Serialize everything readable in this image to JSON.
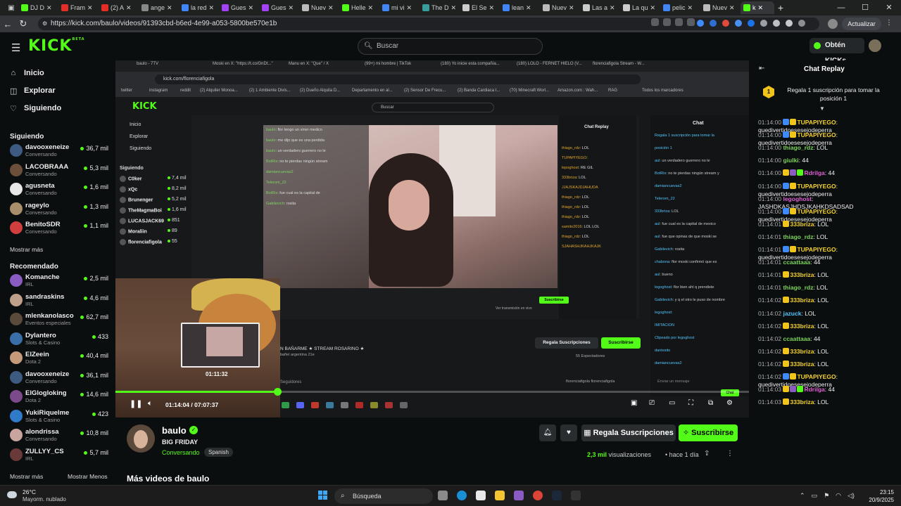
{
  "browser": {
    "tabs": [
      {
        "label": "DJ D",
        "color": "#53fc18"
      },
      {
        "label": "Fram",
        "color": "#e52d27"
      },
      {
        "label": "(2) A",
        "color": "#e52d27"
      },
      {
        "label": "ange",
        "color": "#888888"
      },
      {
        "label": "la red",
        "color": "#4285f4"
      },
      {
        "label": "Gues",
        "color": "#a142f4"
      },
      {
        "label": "Gues",
        "color": "#a142f4"
      },
      {
        "label": "Nuev",
        "color": "#bbbbbb"
      },
      {
        "label": "Helle",
        "color": "#53fc18"
      },
      {
        "label": "mi vi",
        "color": "#4285f4"
      },
      {
        "label": "The D",
        "color": "#3a9d9d"
      },
      {
        "label": "El Se",
        "color": "#cccccc"
      },
      {
        "label": "lean",
        "color": "#4285f4"
      },
      {
        "label": "Nuev",
        "color": "#bbbbbb"
      },
      {
        "label": "Las a",
        "color": "#cccccc"
      },
      {
        "label": "La qu",
        "color": "#cccccc"
      },
      {
        "label": "pelic",
        "color": "#4285f4"
      },
      {
        "label": "Nuev",
        "color": "#bbbbbb"
      }
    ],
    "active_tab": {
      "label": "k",
      "color": "#53fc18"
    },
    "url": "https://kick.com/baulo/videos/91393cbd-b6ed-4e99-a053-5800be570e1b",
    "update_label": "Actualizar"
  },
  "header": {
    "logo": "KICK",
    "logo_sup": "BETA",
    "search_placeholder": "Buscar",
    "kicks_label": "Obtén KICKs"
  },
  "sidebar": {
    "nav": [
      {
        "label": "Inicio",
        "icon": "home-icon"
      },
      {
        "label": "Explorar",
        "icon": "compass-icon"
      },
      {
        "label": "Siguiendo",
        "icon": "heart-icon"
      }
    ],
    "following_title": "Siguiendo",
    "following": [
      {
        "name": "davooxeneize",
        "category": "Conversando",
        "viewers": "36,7 mil",
        "color": "#3d5a80"
      },
      {
        "name": "LACOBRAAA",
        "category": "Conversando",
        "viewers": "5,3 mil",
        "color": "#6b4f3a"
      },
      {
        "name": "agusneta",
        "category": "Conversando",
        "viewers": "1,6 mil",
        "color": "#e8e8e8"
      },
      {
        "name": "rageylo",
        "category": "Conversando",
        "viewers": "1,3 mil",
        "color": "#a88e6a"
      },
      {
        "name": "BenitoSDR",
        "category": "Conversando",
        "viewers": "1,1 mil",
        "color": "#d23d3d"
      }
    ],
    "show_more": "Mostrar más",
    "recommended_title": "Recomendado",
    "recommended": [
      {
        "name": "Komanche",
        "category": "IRL",
        "viewers": "2,5 mil",
        "color": "#8a5cc2"
      },
      {
        "name": "sandraskins",
        "category": "IRL",
        "viewers": "4,6 mil",
        "color": "#bfa08a"
      },
      {
        "name": "mlenkanolasco",
        "category": "Eventos especiales",
        "viewers": "62,7 mil",
        "color": "#5a4a3a"
      },
      {
        "name": "Dylantero",
        "category": "Slots & Casino",
        "viewers": "433",
        "color": "#3a6ea8"
      },
      {
        "name": "ElZeein",
        "category": "Dota 2",
        "viewers": "40,4 mil",
        "color": "#c49a7a"
      },
      {
        "name": "davooxeneize",
        "category": "Conversando",
        "viewers": "36,1 mil",
        "color": "#3d5a80"
      },
      {
        "name": "ElGlogloking",
        "category": "Dota 2",
        "viewers": "14,6 mil",
        "color": "#7a4a8a"
      },
      {
        "name": "YukiRiquelme",
        "category": "Slots & Casino",
        "viewers": "423",
        "color": "#2f7ac9"
      },
      {
        "name": "alondrissa",
        "category": "Conversando",
        "viewers": "10,8 mil",
        "color": "#caa5a0"
      },
      {
        "name": "ZULLYY_CS",
        "category": "IRL",
        "viewers": "5,7 mil",
        "color": "#6a3a3a"
      }
    ],
    "show_more_bottom": "Mostrar más",
    "show_less": "Mostrar Menos"
  },
  "player": {
    "inner_tabs": [
      "baulo - 7TV",
      "Moski en X: \"https://t.co/GnDt...\"",
      "Manu en X: \"Que\" / X",
      "(99+) mi hombre | TikTok",
      "(180) Yo inicie esta compañía...",
      "(180) LOLO - FERNET HIELO (V...",
      "florenciafigola Stream - W..."
    ],
    "inner_url": "kick.com/florenciafigola",
    "bookmarks": [
      "twitter",
      "instagram",
      "reddit",
      "(2) Alquiler Monoa...",
      "(2) 1 Ambiente Divis...",
      "(2) Dueño Alquila D...",
      "Departamento en al...",
      "(2) Sensor De Frecu...",
      "(2) Banda Cardiaca I...",
      "(70) Minecraft Worl...",
      "Amazon.com : Wah...",
      "RAG",
      "Todos los marcadores"
    ],
    "inner_logo": "KICK",
    "inner_search": "Buscar",
    "inner_nav": [
      "Inicio",
      "Explorar",
      "Siguiendo"
    ],
    "inner_following_title": "Siguiendo",
    "inner_following": [
      {
        "name": "C0ker",
        "viewers": "7,4 mil"
      },
      {
        "name": "xQc",
        "viewers": "8,2 mil"
      },
      {
        "name": "Brunenger",
        "viewers": "5,2 mil"
      },
      {
        "name": "TheMagmaBoi",
        "viewers": "1,6 mil"
      },
      {
        "name": "LUCASJACK69",
        "viewers": "851"
      },
      {
        "name": "Moraliin",
        "viewers": "89"
      },
      {
        "name": "florenciafigola",
        "viewers": "55"
      }
    ],
    "inner_overlay_chat": [
      {
        "user": "baulo",
        "text": ": flor tengo un viner medico"
      },
      {
        "user": "baulo",
        "text": ": me dijo que es una perdida"
      },
      {
        "user": "baulo",
        "text": ": un verdadero guerrero no le"
      },
      {
        "user": "BotRix",
        "text": ": no te pierdas ningún stream"
      },
      {
        "user": "damiancuevas2",
        "text": ""
      },
      {
        "user": "Telerom_22",
        "text": ""
      },
      {
        "user": "BotRix",
        "text": ": fue cual es la capital de"
      },
      {
        "user": "Gabilevich",
        "text": ": rosita"
      }
    ],
    "inner_replay_title": "Chat Replay",
    "inner_replay_lines": [
      {
        "user": "thiago_rdz",
        "text": ": LOL"
      },
      {
        "user": "TUPAPIYEGO",
        "text": ":"
      },
      {
        "user": "lepoghost",
        "text": ": RE GIL"
      },
      {
        "user": "333briza",
        "text": ": LOL"
      },
      {
        "user": "JJAJSKAJDJAHUDA",
        "text": ""
      },
      {
        "user": "thiago_rdz",
        "text": ": LOL"
      },
      {
        "user": "thiago_rdz",
        "text": ": LOL"
      },
      {
        "user": "thiago_rdz",
        "text": ": LOL"
      },
      {
        "user": "samito2016",
        "text": ": LOL LOL"
      },
      {
        "user": "thiago_rdz",
        "text": ": LOL"
      },
      {
        "user": "SJAHASHJKAHJKAJK",
        "text": ""
      }
    ],
    "far_chat_title": "Chat",
    "far_chat_lines": [
      {
        "user": "Regala 1 suscripción para tomar la",
        "text": ""
      },
      {
        "user": "posición 1",
        "text": ""
      },
      {
        "user": "aul",
        "text": ": un verdadero guerrero no le"
      },
      {
        "user": "BotRix",
        "text": ": no te pierdas ningún stream y"
      },
      {
        "user": "damiancuevas2",
        "text": ""
      },
      {
        "user": "Telerom_22",
        "text": ""
      },
      {
        "user": "333briza",
        "text": ": LOL"
      },
      {
        "user": "aul",
        "text": ": fue cual es la capital de mexico"
      },
      {
        "user": "aul",
        "text": ": fue que opinas de que moski se"
      },
      {
        "user": "Gabilevich",
        "text": ": rosita"
      },
      {
        "user": "chabona",
        "text": ": flor moski confirmó que es"
      },
      {
        "user": "aul",
        "text": ": bueno"
      },
      {
        "user": "legoghost",
        "text": ": flor bien ahí q prendiste"
      },
      {
        "user": "Gabilevich",
        "text": ": y q el otro le puso de nombre"
      },
      {
        "user": "legoghost",
        "text": ":"
      },
      {
        "user": "IMITACION",
        "text": ""
      },
      {
        "user": "Clipeado por legoghost",
        "text": ""
      },
      {
        "user": "dantesito",
        "text": ""
      },
      {
        "user": "damiancuevas2",
        "text": ""
      }
    ],
    "inner_message_placeholder": "Enviar un mensaje",
    "inner_chat_btn": "Chat",
    "inner_stream_title": "N BAÑARME ★ STREAM ROSARINO ★",
    "inner_tags": "bañel  argentina  21e",
    "inner_gift": "Regala Suscripciones",
    "inner_sub": "Suscribirse",
    "inner_spectators": "55 Espectadores",
    "inner_green_small": "Suscribirse",
    "inner_sub_bar": "Ver transmisión en vivo",
    "inner_segment": "Seguidores",
    "inner_socials": "florenciafigola    florenciafigola",
    "hover_time": "01:11:32",
    "progress": 0.255,
    "current_time": "01:14:04",
    "duration": "07:07:37"
  },
  "video": {
    "streamer": "baulo",
    "title": "BIG FRIDAY",
    "category": "Conversando",
    "language": "Spanish",
    "gift_label": "Regala Suscripciones",
    "subscribe_label": "Suscribirse",
    "views": "2,3 mil",
    "views_suffix": "visualizaciones",
    "posted": "hace 1 día",
    "more_videos": "Más videos de baulo"
  },
  "chat": {
    "title": "Chat Replay",
    "pinned": "Regala 1 suscripción para tomar la posición 1",
    "messages": [
      {
        "time": "01:14:00",
        "user": "TUPAPIYEGO",
        "color": "#f6d32d",
        "badges": [
          "#3d8bfd",
          "#f0c419"
        ],
        "text": ": quedivertidoesesejodeperra"
      },
      {
        "time": "01:14:00",
        "user": "TUPAPIYEGO",
        "color": "#f6d32d",
        "badges": [
          "#3d8bfd",
          "#f0c419"
        ],
        "text": ": quedivertidoesesejodeperra"
      },
      {
        "time": "01:14:00",
        "user": "thiago_rdz",
        "color": "#7bd35a",
        "badges": [],
        "text": ": LOL"
      },
      {
        "time": "01:14:00",
        "user": "giulki",
        "color": "#7bd35a",
        "badges": [],
        "text": ": 44"
      },
      {
        "time": "01:14:00",
        "user": "Rdrilga",
        "color": "#e05fd6",
        "badges": [
          "#f0c419",
          "#8a5cc2",
          "#53fc18"
        ],
        "text": ": 44"
      },
      {
        "time": "01:14:00",
        "user": "TUPAPIYEGO",
        "color": "#f6d32d",
        "badges": [
          "#3d8bfd",
          "#f0c419"
        ],
        "text": ": quedivertidoesesejodeperra"
      },
      {
        "time": "01:14:00",
        "user": "legoghost",
        "color": "#e05fd6",
        "badges": [],
        "text": ": JASHDKASJHDSJKAHKDSADSAD"
      },
      {
        "time": "01:14:00",
        "user": "TUPAPIYEGO",
        "color": "#f6d32d",
        "badges": [
          "#3d8bfd",
          "#f0c419"
        ],
        "text": ": quedivertidoesesejodeperra"
      },
      {
        "time": "01:14:01",
        "user": "333briza",
        "color": "#f6d32d",
        "badges": [
          "#f0c419"
        ],
        "text": ": LOL"
      },
      {
        "time": "01:14:01",
        "user": "thiago_rdz",
        "color": "#7bd35a",
        "badges": [],
        "text": ": LOL"
      },
      {
        "time": "01:14:01",
        "user": "TUPAPIYEGO",
        "color": "#f6d32d",
        "badges": [
          "#3d8bfd",
          "#f0c419"
        ],
        "text": ": quedivertidoesesejodeperra"
      },
      {
        "time": "01:14:01",
        "user": "ccaattaaa",
        "color": "#7bd35a",
        "badges": [],
        "text": ": 44"
      },
      {
        "time": "01:14:01",
        "user": "333briza",
        "color": "#f6d32d",
        "badges": [
          "#f0c419"
        ],
        "text": ": LOL"
      },
      {
        "time": "01:14:01",
        "user": "thiago_rdz",
        "color": "#7bd35a",
        "badges": [],
        "text": ": LOL"
      },
      {
        "time": "01:14:02",
        "user": "333briza",
        "color": "#f6d32d",
        "badges": [
          "#f0c419"
        ],
        "text": ": LOL"
      },
      {
        "time": "01:14:02",
        "user": "jazuck",
        "color": "#53c3fc",
        "badges": [],
        "text": ": LOL"
      },
      {
        "time": "01:14:02",
        "user": "333briza",
        "color": "#f6d32d",
        "badges": [
          "#f0c419"
        ],
        "text": ": LOL"
      },
      {
        "time": "01:14:02",
        "user": "ccaattaaa",
        "color": "#7bd35a",
        "badges": [],
        "text": ": 44"
      },
      {
        "time": "01:14:02",
        "user": "333briza",
        "color": "#f6d32d",
        "badges": [
          "#f0c419"
        ],
        "text": ": LOL"
      },
      {
        "time": "01:14:02",
        "user": "333briza",
        "color": "#f6d32d",
        "badges": [
          "#f0c419"
        ],
        "text": ": LOL"
      },
      {
        "time": "01:14:02",
        "user": "TUPAPIYEGO",
        "color": "#f6d32d",
        "badges": [
          "#3d8bfd",
          "#f0c419"
        ],
        "text": ": quedivertidoesesejodeperra"
      },
      {
        "time": "01:14:03",
        "user": "Rdrilga",
        "color": "#e05fd6",
        "badges": [
          "#f0c419",
          "#8a5cc2",
          "#53fc18"
        ],
        "text": ": 44"
      },
      {
        "time": "01:14:03",
        "user": "333briza",
        "color": "#f6d32d",
        "badges": [
          "#f0c419"
        ],
        "text": ": LOL"
      }
    ]
  },
  "taskbar": {
    "temp": "26°C",
    "condition": "Mayorm. nublado",
    "search": "Búsqueda",
    "time": "23:15",
    "date": "20/9/2025"
  },
  "colors": {
    "accent": "#53fc18",
    "background": "#0b0e0f"
  }
}
